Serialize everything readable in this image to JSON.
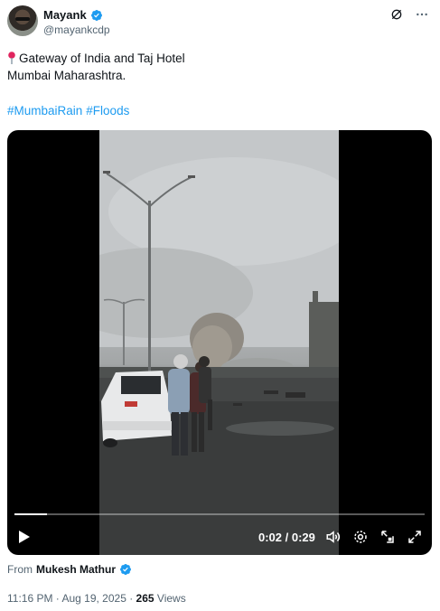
{
  "author": {
    "name": "Mayank",
    "handle": "@mayankcdp"
  },
  "post": {
    "location_pin": "📍",
    "line1": "Gateway of India and Taj Hotel",
    "line2": "Mumbai Maharashtra.",
    "hashtags": [
      "#MumbaiRain",
      "#Floods"
    ]
  },
  "video": {
    "time_display": "0:02 / 0:29",
    "progress": 0.079
  },
  "attribution": {
    "from_label": "From",
    "from_name": "Mukesh Mathur"
  },
  "meta": {
    "timestamp": "11:16 PM · Aug 19, 2025 ·",
    "views_count": "265",
    "views_label": "Views"
  },
  "colors": {
    "verified_blue": "#1d9bf0",
    "hashtag": "#1d9bf0"
  }
}
